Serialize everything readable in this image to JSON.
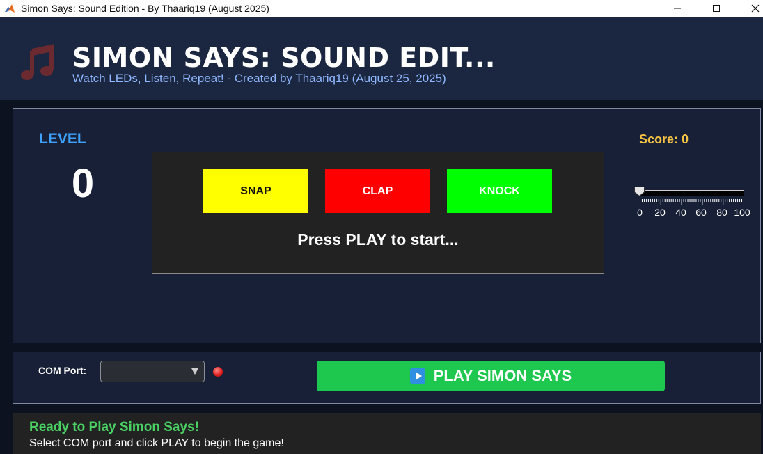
{
  "window": {
    "title": "Simon Says: Sound Edition - By Thaariq19 (August 2025)",
    "minimize_glyph": "—",
    "maximize_glyph": "☐",
    "close_glyph": "✕"
  },
  "header": {
    "title": "SIMON SAYS: SOUND EDIT...",
    "subtitle": "Watch LEDs, Listen, Repeat! - Created by Thaariq19 (August 25, 2025)",
    "icon": "music-note-icon"
  },
  "game": {
    "level_label": "LEVEL",
    "level_value": "0",
    "score_text": "Score: 0",
    "buttons": [
      {
        "label": "SNAP",
        "color": "#ffff00"
      },
      {
        "label": "CLAP",
        "color": "#ff0000"
      },
      {
        "label": "KNOCK",
        "color": "#00ff00"
      }
    ],
    "status_message": "Press PLAY to start..."
  },
  "volume_slider": {
    "value": 0,
    "min": 0,
    "max": 100,
    "tick_labels": [
      "0",
      "20",
      "40",
      "60",
      "80",
      "100"
    ]
  },
  "controls": {
    "com_label": "COM Port:",
    "com_selected": "",
    "led_color": "#e0201e",
    "play_label": "PLAY SIMON SAYS",
    "play_color": "#1ec74e"
  },
  "status_bar": {
    "title": "Ready to Play Simon Says!",
    "subtitle": "Select COM port and click PLAY to begin the game!"
  }
}
